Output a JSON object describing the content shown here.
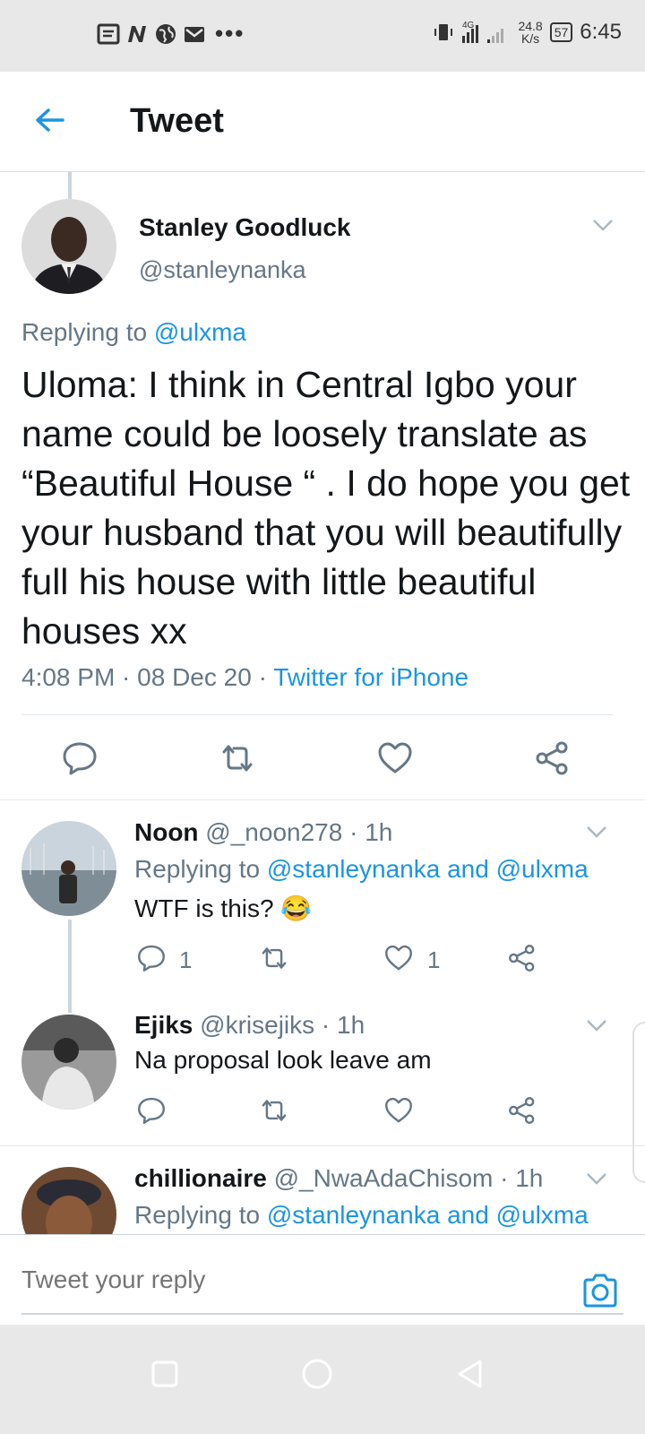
{
  "status_bar": {
    "time": "6:45",
    "network": "4G",
    "speed_value": "24.8",
    "speed_unit": "K/s",
    "battery": "57",
    "notification_icons": [
      "document-icon",
      "n-icon",
      "globe-icon",
      "mail-icon"
    ]
  },
  "header": {
    "title": "Tweet"
  },
  "main_tweet": {
    "name": "Stanley Goodluck",
    "handle": "@stanleynanka",
    "replying_prefix": "Replying to ",
    "replying_to": "@ulxma",
    "text": "Uloma: I think in Central Igbo your name could be loosely translate as “Beautiful House “ . I do hope you get your husband that you will beautifully full his house with little beautiful houses xx",
    "time": "4:08 PM · 08 Dec 20 · ",
    "source": "Twitter for iPhone"
  },
  "replies": [
    {
      "name": "Noon",
      "handle_time": " @_noon278 · 1h",
      "replying_prefix": "Replying to ",
      "replying_to": "@stanleynanka and @ulxma",
      "text": "WTF is this? 😂",
      "reply_count": "1",
      "like_count": "1"
    },
    {
      "name": "Ejiks",
      "handle_time": " @krisejiks · 1h",
      "text": "Na proposal look leave am",
      "reply_count": "",
      "like_count": ""
    },
    {
      "name": "chillionaire",
      "handle_time": " @_NwaAdaChisom · 1h",
      "replying_prefix": "Replying to ",
      "replying_to": "@stanleynanka and @ulxma"
    }
  ],
  "reply_box": {
    "placeholder": "Tweet your reply"
  },
  "colors": {
    "accent": "#1b95e0",
    "secondary_text": "#657786",
    "icon_gray": "#657786"
  }
}
